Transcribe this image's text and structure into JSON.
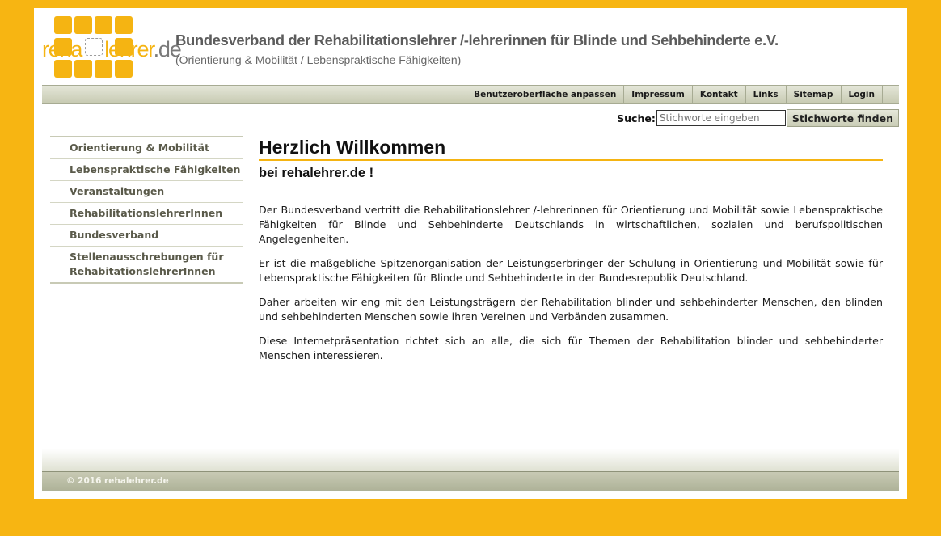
{
  "logo": {
    "text_reha": "reha",
    "text_lehrer": "lehrer",
    "text_de": ".de",
    "colors": {
      "yellow": "#F5B412",
      "grey": "#7a7a7a"
    }
  },
  "header": {
    "title": "Bundesverband der Rehabilitationslehrer /-lehrerinnen für Blinde und Sehbehinderte e.V.",
    "subtitle": "(Orientierung & Mobilität / Lebenspraktische Fähigkeiten)"
  },
  "topnav": [
    "Benutzeroberfläche anpassen",
    "Impressum",
    "Kontakt",
    "Links",
    "Sitemap",
    "Login"
  ],
  "search": {
    "label": "Suche:",
    "placeholder": "Stichworte eingeben",
    "button": "Stichworte finden"
  },
  "sidebar": [
    "Orientierung & Mobilität",
    "Lebenspraktische Fähigkeiten",
    "Veranstaltungen",
    "RehabilitationslehrerInnen",
    "Bundesverband",
    "Stellenausschrebungen für RehabitationslehrerInnen"
  ],
  "main": {
    "heading": "Herzlich Willkommen",
    "subheading": "bei rehalehrer.de !",
    "paragraphs": [
      "Der Bundesverband vertritt die Rehabilitationslehrer /-lehrerinnen für Orientierung und Mobilität sowie Lebenspraktische Fähigkeiten für Blinde und Sehbehinderte Deutschlands in wirtschaftlichen, sozialen und berufspolitischen Angelegenheiten.",
      "Er ist die maßgebliche Spitzenorganisation der Leistungserbringer der Schulung in Orientierung und Mobilität sowie für Lebenspraktische Fähigkeiten für Blinde und Sehbehinderte in der Bundesrepublik Deutschland.",
      "Daher arbeiten wir eng mit den Leistungsträgern der Rehabilitation blinder und sehbehinderter Menschen, den blinden und sehbehinderten Menschen sowie ihren Vereinen und Verbänden zusammen.",
      "Diese Internetpräsentation richtet sich an alle, die sich für Themen der Rehabilitation blinder und sehbehinderter Menschen interessieren."
    ]
  },
  "footer": {
    "copyright": "© 2016 rehalehrer.de"
  },
  "colors": {
    "background": "#F7B512",
    "accent": "#F5B412",
    "navbar": "#c7cab2"
  }
}
